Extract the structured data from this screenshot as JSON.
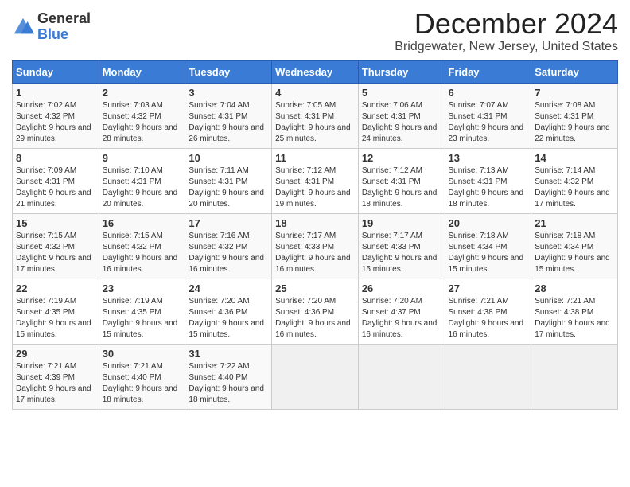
{
  "logo": {
    "general": "General",
    "blue": "Blue"
  },
  "title": "December 2024",
  "location": "Bridgewater, New Jersey, United States",
  "headers": [
    "Sunday",
    "Monday",
    "Tuesday",
    "Wednesday",
    "Thursday",
    "Friday",
    "Saturday"
  ],
  "weeks": [
    [
      {
        "day": "1",
        "sunrise": "Sunrise: 7:02 AM",
        "sunset": "Sunset: 4:32 PM",
        "daylight": "Daylight: 9 hours and 29 minutes."
      },
      {
        "day": "2",
        "sunrise": "Sunrise: 7:03 AM",
        "sunset": "Sunset: 4:32 PM",
        "daylight": "Daylight: 9 hours and 28 minutes."
      },
      {
        "day": "3",
        "sunrise": "Sunrise: 7:04 AM",
        "sunset": "Sunset: 4:31 PM",
        "daylight": "Daylight: 9 hours and 26 minutes."
      },
      {
        "day": "4",
        "sunrise": "Sunrise: 7:05 AM",
        "sunset": "Sunset: 4:31 PM",
        "daylight": "Daylight: 9 hours and 25 minutes."
      },
      {
        "day": "5",
        "sunrise": "Sunrise: 7:06 AM",
        "sunset": "Sunset: 4:31 PM",
        "daylight": "Daylight: 9 hours and 24 minutes."
      },
      {
        "day": "6",
        "sunrise": "Sunrise: 7:07 AM",
        "sunset": "Sunset: 4:31 PM",
        "daylight": "Daylight: 9 hours and 23 minutes."
      },
      {
        "day": "7",
        "sunrise": "Sunrise: 7:08 AM",
        "sunset": "Sunset: 4:31 PM",
        "daylight": "Daylight: 9 hours and 22 minutes."
      }
    ],
    [
      {
        "day": "8",
        "sunrise": "Sunrise: 7:09 AM",
        "sunset": "Sunset: 4:31 PM",
        "daylight": "Daylight: 9 hours and 21 minutes."
      },
      {
        "day": "9",
        "sunrise": "Sunrise: 7:10 AM",
        "sunset": "Sunset: 4:31 PM",
        "daylight": "Daylight: 9 hours and 20 minutes."
      },
      {
        "day": "10",
        "sunrise": "Sunrise: 7:11 AM",
        "sunset": "Sunset: 4:31 PM",
        "daylight": "Daylight: 9 hours and 20 minutes."
      },
      {
        "day": "11",
        "sunrise": "Sunrise: 7:12 AM",
        "sunset": "Sunset: 4:31 PM",
        "daylight": "Daylight: 9 hours and 19 minutes."
      },
      {
        "day": "12",
        "sunrise": "Sunrise: 7:12 AM",
        "sunset": "Sunset: 4:31 PM",
        "daylight": "Daylight: 9 hours and 18 minutes."
      },
      {
        "day": "13",
        "sunrise": "Sunrise: 7:13 AM",
        "sunset": "Sunset: 4:31 PM",
        "daylight": "Daylight: 9 hours and 18 minutes."
      },
      {
        "day": "14",
        "sunrise": "Sunrise: 7:14 AM",
        "sunset": "Sunset: 4:32 PM",
        "daylight": "Daylight: 9 hours and 17 minutes."
      }
    ],
    [
      {
        "day": "15",
        "sunrise": "Sunrise: 7:15 AM",
        "sunset": "Sunset: 4:32 PM",
        "daylight": "Daylight: 9 hours and 17 minutes."
      },
      {
        "day": "16",
        "sunrise": "Sunrise: 7:15 AM",
        "sunset": "Sunset: 4:32 PM",
        "daylight": "Daylight: 9 hours and 16 minutes."
      },
      {
        "day": "17",
        "sunrise": "Sunrise: 7:16 AM",
        "sunset": "Sunset: 4:32 PM",
        "daylight": "Daylight: 9 hours and 16 minutes."
      },
      {
        "day": "18",
        "sunrise": "Sunrise: 7:17 AM",
        "sunset": "Sunset: 4:33 PM",
        "daylight": "Daylight: 9 hours and 16 minutes."
      },
      {
        "day": "19",
        "sunrise": "Sunrise: 7:17 AM",
        "sunset": "Sunset: 4:33 PM",
        "daylight": "Daylight: 9 hours and 15 minutes."
      },
      {
        "day": "20",
        "sunrise": "Sunrise: 7:18 AM",
        "sunset": "Sunset: 4:34 PM",
        "daylight": "Daylight: 9 hours and 15 minutes."
      },
      {
        "day": "21",
        "sunrise": "Sunrise: 7:18 AM",
        "sunset": "Sunset: 4:34 PM",
        "daylight": "Daylight: 9 hours and 15 minutes."
      }
    ],
    [
      {
        "day": "22",
        "sunrise": "Sunrise: 7:19 AM",
        "sunset": "Sunset: 4:35 PM",
        "daylight": "Daylight: 9 hours and 15 minutes."
      },
      {
        "day": "23",
        "sunrise": "Sunrise: 7:19 AM",
        "sunset": "Sunset: 4:35 PM",
        "daylight": "Daylight: 9 hours and 15 minutes."
      },
      {
        "day": "24",
        "sunrise": "Sunrise: 7:20 AM",
        "sunset": "Sunset: 4:36 PM",
        "daylight": "Daylight: 9 hours and 15 minutes."
      },
      {
        "day": "25",
        "sunrise": "Sunrise: 7:20 AM",
        "sunset": "Sunset: 4:36 PM",
        "daylight": "Daylight: 9 hours and 16 minutes."
      },
      {
        "day": "26",
        "sunrise": "Sunrise: 7:20 AM",
        "sunset": "Sunset: 4:37 PM",
        "daylight": "Daylight: 9 hours and 16 minutes."
      },
      {
        "day": "27",
        "sunrise": "Sunrise: 7:21 AM",
        "sunset": "Sunset: 4:38 PM",
        "daylight": "Daylight: 9 hours and 16 minutes."
      },
      {
        "day": "28",
        "sunrise": "Sunrise: 7:21 AM",
        "sunset": "Sunset: 4:38 PM",
        "daylight": "Daylight: 9 hours and 17 minutes."
      }
    ],
    [
      {
        "day": "29",
        "sunrise": "Sunrise: 7:21 AM",
        "sunset": "Sunset: 4:39 PM",
        "daylight": "Daylight: 9 hours and 17 minutes."
      },
      {
        "day": "30",
        "sunrise": "Sunrise: 7:21 AM",
        "sunset": "Sunset: 4:40 PM",
        "daylight": "Daylight: 9 hours and 18 minutes."
      },
      {
        "day": "31",
        "sunrise": "Sunrise: 7:22 AM",
        "sunset": "Sunset: 4:40 PM",
        "daylight": "Daylight: 9 hours and 18 minutes."
      },
      null,
      null,
      null,
      null
    ]
  ]
}
